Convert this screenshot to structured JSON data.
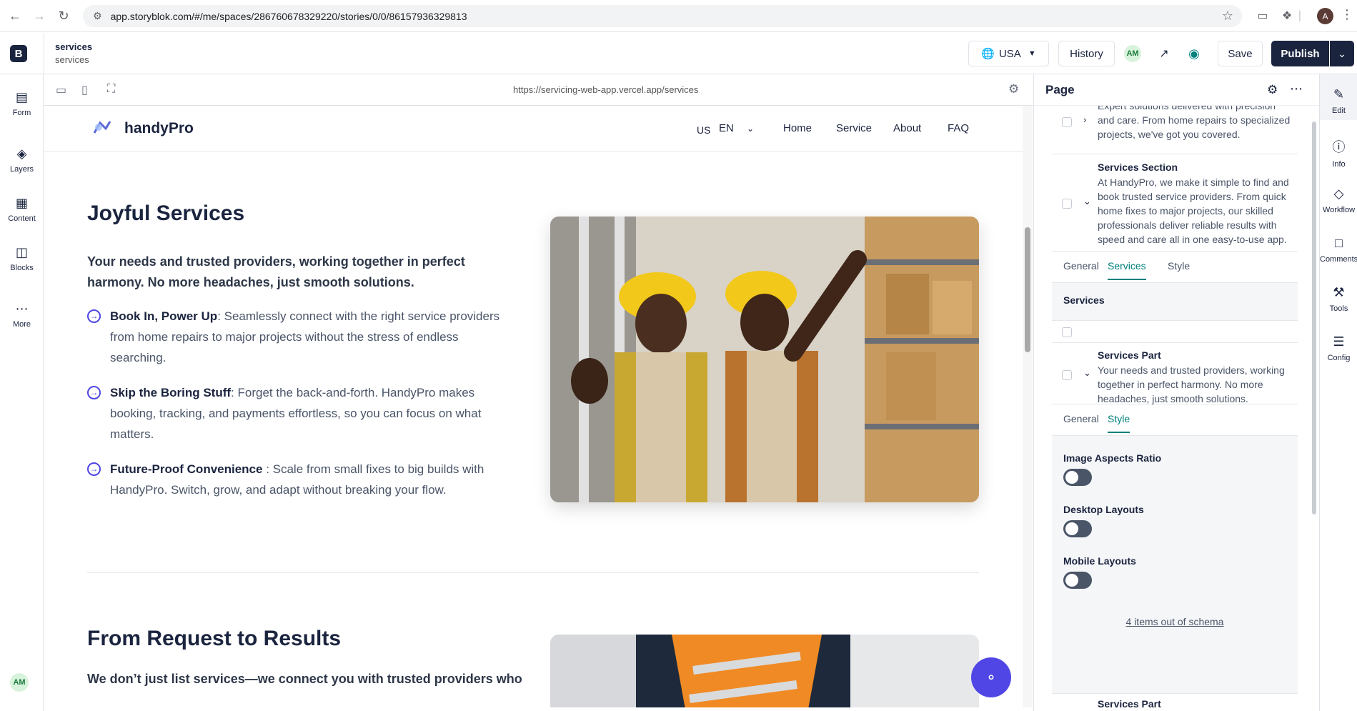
{
  "browser": {
    "url": "app.storyblok.com/#/me/spaces/286760678329220/stories/0/0/86157936329813",
    "profile_initial": "A"
  },
  "topbar": {
    "story_title": "services",
    "story_slug": "services",
    "locale": "USA",
    "history_label": "History",
    "user_initials": "AM",
    "save_label": "Save",
    "publish_label": "Publish"
  },
  "left_nav": {
    "items": [
      {
        "label": "Form",
        "icon": "form-icon"
      },
      {
        "label": "Layers",
        "icon": "layers-icon"
      },
      {
        "label": "Content",
        "icon": "content-icon"
      },
      {
        "label": "Blocks",
        "icon": "blocks-icon"
      },
      {
        "label": "More",
        "icon": "more-icon"
      }
    ],
    "user_initials": "AM"
  },
  "preview": {
    "url": "https://servicing-web-app.vercel.app/services",
    "site": {
      "brand": "handyPro",
      "country": "US",
      "language": "EN",
      "nav": [
        "Home",
        "Service",
        "About",
        "FAQ"
      ]
    },
    "section1": {
      "title": "Joyful Services",
      "lead": "Your needs and trusted providers, working together in perfect harmony. No more headaches, just smooth solutions.",
      "bullets": [
        {
          "bold": "Book In, Power Up",
          "text": ": Seamlessly connect with the right service providers from home repairs to major projects without the stress of endless searching."
        },
        {
          "bold": "Skip the Boring Stuff",
          "text": ": Forget the back-and-forth. HandyPro makes booking, tracking, and payments effortless, so you can focus on what matters."
        },
        {
          "bold": "Future-Proof Convenience ",
          "text": ": Scale from small fixes to big builds with HandyPro. Switch, grow, and adapt without breaking your flow."
        }
      ]
    },
    "section2": {
      "title": "From Request to Results",
      "lead": "We don’t just list services—we connect you with trusted providers who"
    }
  },
  "panel": {
    "title": "Page",
    "top_card_text": "Expert solutions delivered with precision and care. From home repairs to specialized projects, we've got you covered.",
    "services_section": {
      "title": "Services Section",
      "desc": "At HandyPro, we make it simple to find and book trusted service providers. From quick home fixes to major projects, our skilled professionals deliver reliable results with speed and care all in one easy-to-use app."
    },
    "tabs1": [
      "General",
      "Services",
      "Style"
    ],
    "services_label": "Services",
    "services_part": {
      "title": "Services Part",
      "desc": "Your needs and trusted providers, working together in perfect harmony. No more headaches, just smooth solutions."
    },
    "tabs2": [
      "General",
      "Style"
    ],
    "fields": [
      {
        "label": "Image Aspects Ratio",
        "on": false
      },
      {
        "label": "Desktop Layouts",
        "on": false
      },
      {
        "label": "Mobile Layouts",
        "on": false
      }
    ],
    "schema_link": "4 items out of schema",
    "next_card_title": "Services Part"
  },
  "right_nav": {
    "items": [
      {
        "label": "Edit",
        "icon": "pencil-icon"
      },
      {
        "label": "Info",
        "icon": "info-icon"
      },
      {
        "label": "Workflow",
        "icon": "workflow-icon"
      },
      {
        "label": "Comments",
        "icon": "comments-icon"
      },
      {
        "label": "Tools",
        "icon": "tools-icon"
      },
      {
        "label": "Config",
        "icon": "config-icon"
      }
    ]
  },
  "colors": {
    "brand_dark": "#1b243f",
    "accent_teal": "#00807d",
    "indigo": "#4f46e5"
  }
}
